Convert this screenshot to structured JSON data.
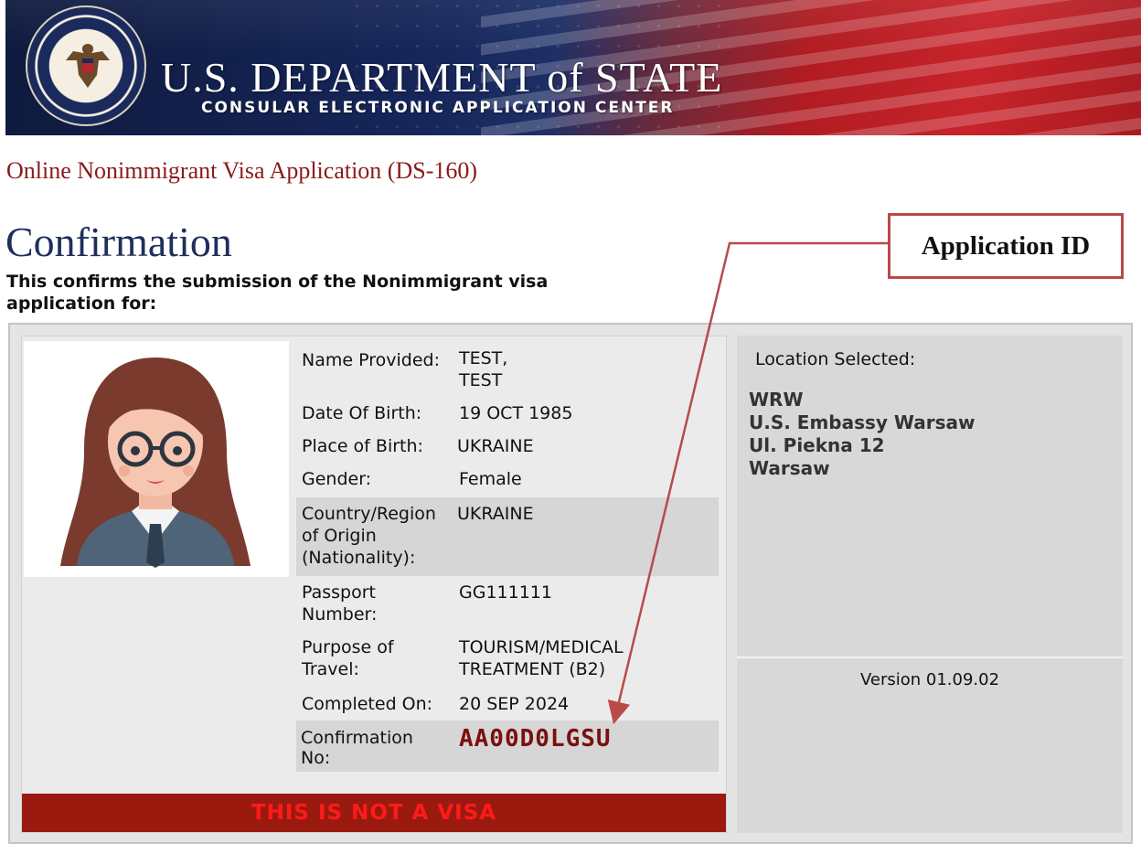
{
  "banner": {
    "title": "U.S. DEPARTMENT of STATE",
    "subtitle": "CONSULAR ELECTRONIC APPLICATION CENTER"
  },
  "app_title": "Online Nonimmigrant Visa Application (DS-160)",
  "page_heading": "Confirmation",
  "intro": "This confirms the submission of the Nonimmigrant visa application for:",
  "callout": {
    "label": "Application ID"
  },
  "applicant": {
    "name_label": "Name Provided:",
    "name_value": "TEST, TEST",
    "dob_label": "Date Of Birth:",
    "dob_value": "19 OCT 1985",
    "pob_label": "Place of Birth:",
    "pob_value": "UKRAINE",
    "gender_label": "Gender:",
    "gender_value": "Female",
    "nationality_label": "Country/Region of Origin (Nationality):",
    "nationality_value": "UKRAINE",
    "passport_label": "Passport Number:",
    "passport_value": "GG111111",
    "purpose_label": "Purpose of Travel:",
    "purpose_value": "TOURISM/MEDICAL TREATMENT (B2)",
    "completed_label": "Completed On:",
    "completed_value": "20 SEP 2024",
    "confirmation_label": "Confirmation No:",
    "confirmation_value": "AA00D0LGSU"
  },
  "not_visa": "THIS IS NOT A VISA",
  "location": {
    "label": "Location Selected:",
    "line1": "WRW",
    "line2": "U.S. Embassy Warsaw",
    "line3": "Ul. Piekna 12",
    "line4": "Warsaw"
  },
  "version": "Version 01.09.02",
  "colors": {
    "accent_red": "#8b1a1a",
    "heading_blue": "#1f2f5c",
    "confirmation_red": "#7a0f0f",
    "not_visa_bg": "#9a1a0f",
    "not_visa_text": "#ff1a1a",
    "callout_border": "#b94a4a"
  },
  "icons": [
    "department-of-state-seal",
    "applicant-photo"
  ]
}
